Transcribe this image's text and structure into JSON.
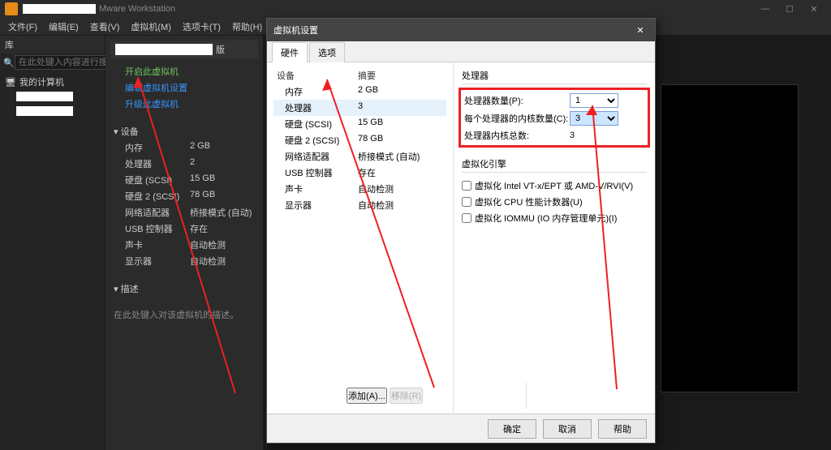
{
  "app": {
    "title": "Mware Workstation"
  },
  "menu": {
    "file": "文件(F)",
    "edit": "编辑(E)",
    "view": "查看(V)",
    "vm": "虚拟机(M)",
    "tabs": "选项卡(T)",
    "help": "帮助(H)"
  },
  "library": {
    "header": "库",
    "search_placeholder": "在此处键入内容进行搜索",
    "root": "我的计算机"
  },
  "vm": {
    "tab_suffix": "版",
    "actions": {
      "power_on": "开启此虚拟机",
      "edit": "编辑虚拟机设置",
      "upgrade": "升级此虚拟机"
    },
    "devices_header": "设备",
    "devices": [
      {
        "label": "内存",
        "value": "2 GB"
      },
      {
        "label": "处理器",
        "value": "2"
      },
      {
        "label": "硬盘 (SCSI)",
        "value": "15 GB"
      },
      {
        "label": "硬盘 2 (SCSI)",
        "value": "78 GB"
      },
      {
        "label": "网络适配器",
        "value": "桥接模式 (自动)"
      },
      {
        "label": "USB 控制器",
        "value": "存在"
      },
      {
        "label": "声卡",
        "value": "自动检测"
      },
      {
        "label": "显示器",
        "value": "自动检测"
      }
    ],
    "desc_header": "描述",
    "desc_placeholder": "在此处键入对该虚拟机的描述。"
  },
  "dialog": {
    "title": "虚拟机设置",
    "tabs": {
      "hardware": "硬件",
      "options": "选项"
    },
    "list_headers": {
      "device": "设备",
      "summary": "摘要"
    },
    "list": [
      {
        "label": "内存",
        "value": "2 GB"
      },
      {
        "label": "处理器",
        "value": "3"
      },
      {
        "label": "硬盘 (SCSI)",
        "value": "15 GB"
      },
      {
        "label": "硬盘 2 (SCSI)",
        "value": "78 GB"
      },
      {
        "label": "网络适配器",
        "value": "桥接模式 (自动)"
      },
      {
        "label": "USB 控制器",
        "value": "存在"
      },
      {
        "label": "声卡",
        "value": "自动检测"
      },
      {
        "label": "显示器",
        "value": "自动检测"
      }
    ],
    "add": "添加(A)...",
    "remove": "移除(R)",
    "processor": {
      "group": "处理器",
      "num_procs": "处理器数量(P):",
      "num_procs_val": "1",
      "cores_per": "每个处理器的内核数量(C):",
      "cores_per_val": "3",
      "total": "处理器内核总数:",
      "total_val": "3"
    },
    "virt": {
      "group": "虚拟化引擎",
      "vt": "虚拟化 Intel VT-x/EPT 或 AMD-V/RVI(V)",
      "cpu_perf": "虚拟化 CPU 性能计数器(U)",
      "iommu": "虚拟化 IOMMU (IO 内存管理单元)(I)"
    },
    "ok": "确定",
    "cancel": "取消",
    "help": "帮助"
  }
}
